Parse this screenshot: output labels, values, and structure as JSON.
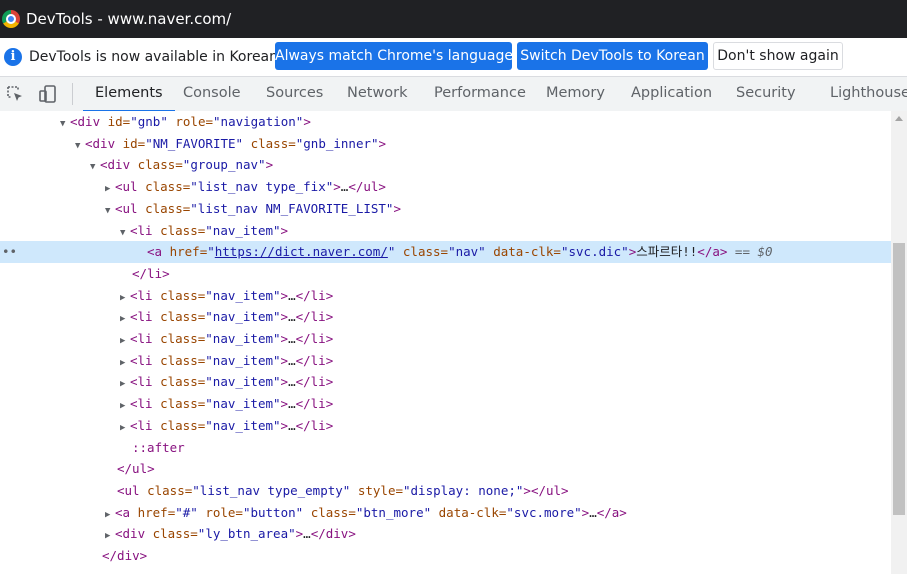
{
  "window": {
    "title": "DevTools - www.naver.com/"
  },
  "infobar": {
    "message": "DevTools is now available in Korean!",
    "buttons": {
      "match_language": "Always match Chrome's language",
      "switch_korean": "Switch DevTools to Korean",
      "dont_show": "Don't show again"
    }
  },
  "tabs": [
    "Elements",
    "Console",
    "Sources",
    "Network",
    "Performance",
    "Memory",
    "Application",
    "Security",
    "Lighthouse"
  ],
  "active_tab": "Elements",
  "tree": {
    "l1": {
      "tag_open": "<div",
      "a1": " id=",
      "v1": "\"gnb\"",
      "a2": " role=",
      "v2": "\"navigation\"",
      "tag_close": ">"
    },
    "l2": {
      "tag_open": "<div",
      "a1": " id=",
      "v1": "\"NM_FAVORITE\"",
      "a2": " class=",
      "v2": "\"gnb_inner\"",
      "tag_close": ">"
    },
    "l3": {
      "tag_open": "<div",
      "a1": " class=",
      "v1": "\"group_nav\"",
      "tag_close": ">"
    },
    "l4": {
      "tag_open": "<ul",
      "a1": " class=",
      "v1": "\"list_nav type_fix\"",
      "tag_close": ">",
      "ellipsis": "…",
      "end_tag": "</ul>"
    },
    "l5": {
      "tag_open": "<ul",
      "a1": " class=",
      "v1": "\"list_nav NM_FAVORITE_LIST\"",
      "tag_close": ">"
    },
    "l6": {
      "tag_open": "<li",
      "a1": " class=",
      "v1": "\"nav_item\"",
      "tag_close": ">"
    },
    "l7": {
      "dots": "••",
      "tag_open": "<a",
      "a1": " href=",
      "q1": "\"",
      "link": "https://dict.naver.com/",
      "q2": "\"",
      "a2": " class=",
      "v2": "\"nav\"",
      "a3": " data-clk=",
      "v3": "\"svc.dic\"",
      "tag_close": ">",
      "text": "스파르타!!",
      "end_tag": "</a>",
      "marker": " == $0"
    },
    "l8": {
      "end_tag": "</li>"
    },
    "collapsed_li": {
      "tag_open": "<li",
      "a1": " class=",
      "v1": "\"nav_item\"",
      "tag_close": ">",
      "ellipsis": "…",
      "end_tag": "</li>"
    },
    "after": "::after",
    "ul_close": "</ul>",
    "l18": {
      "tag_open": "<ul",
      "a1": " class=",
      "v1": "\"list_nav type_empty\"",
      "a2": " style=",
      "v2": "\"display: none;\"",
      "tag_close": ">",
      "end_tag": "</ul>"
    },
    "l19": {
      "tag_open": "<a",
      "a1": " href=",
      "v1": "\"#\"",
      "a2": " role=",
      "v2": "\"button\"",
      "a3": " class=",
      "v3": "\"btn_more\"",
      "a4": " data-clk=",
      "v4": "\"svc.more\"",
      "tag_close": ">",
      "ellipsis": "…",
      "end_tag": "</a>"
    },
    "l20": {
      "tag_open": "<div",
      "a1": " class=",
      "v1": "\"ly_btn_area\"",
      "tag_close": ">",
      "ellipsis": "…",
      "end_tag": "</div>"
    },
    "div_close": "</div>"
  },
  "colors": {
    "accent": "#1a73e8",
    "tag": "#881280",
    "attr_name": "#994500",
    "attr_value": "#1a1aa6",
    "selected_row": "#cfe8fc"
  },
  "icons": [
    "chrome-logo-icon",
    "info-icon",
    "inspect-element-icon",
    "device-toolbar-icon",
    "scroll-up-arrow-icon"
  ]
}
